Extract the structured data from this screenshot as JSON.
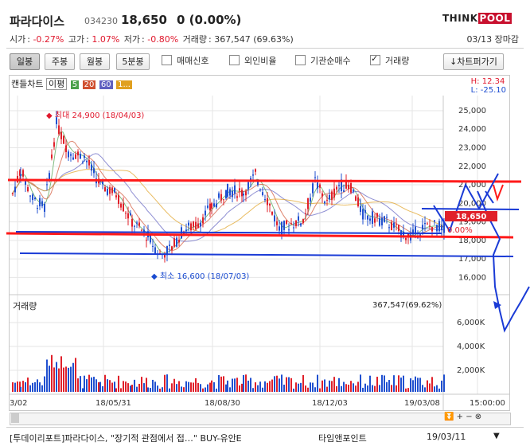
{
  "header": {
    "name": "파라다이스",
    "code": "034230",
    "price": "18,650",
    "change": "0 (0.00%)",
    "logo_think": "THINK",
    "logo_pool": "POOL",
    "start_label": "시가",
    "start_val": "-0.27%",
    "high_label": "고가",
    "high_val": "1.07%",
    "low_label": "저가",
    "low_val": "-0.80%",
    "vol_label": "거래량",
    "vol_val": "367,547 (69.63%)",
    "close_date": "03/13 장마감"
  },
  "toolbar": {
    "periods": [
      "일봉",
      "주봉",
      "월봉",
      "5분봉"
    ],
    "checks": [
      {
        "label": "매매신호",
        "checked": false
      },
      {
        "label": "외인비율",
        "checked": false
      },
      {
        "label": "기관순매수",
        "checked": false
      },
      {
        "label": "거래량",
        "checked": true
      }
    ],
    "download": "↓차트퍼가기"
  },
  "legend": {
    "chart_label": "캔들차트",
    "ma_label": "이평",
    "ma": [
      {
        "label": "5",
        "color": "#4aa04a"
      },
      {
        "label": "20",
        "color": "#d05030"
      },
      {
        "label": "60",
        "color": "#6060c0"
      },
      {
        "label": "1...",
        "color": "#e0a020"
      }
    ],
    "high_text": "H: 12.34",
    "low_text": "L: -25.10"
  },
  "chart_data": {
    "type": "candlestick",
    "price_axis": [
      "25,000",
      "24,000",
      "23,000",
      "22,000",
      "21,000",
      "20,000",
      "19,000",
      "18,000",
      "17,000",
      "16,000"
    ],
    "ylim": [
      15500,
      25600
    ],
    "current_price_tag": "18,650",
    "overlay_pct_tag": "0.00%",
    "max_label": "최대 24,900 (18/04/03)",
    "min_label": "최소 16,600 (18/07/03)",
    "volume_label": "거래량",
    "volume_value": "367,547(69.62%)",
    "volume_axis": [
      "6,000K",
      "4,000K",
      "2,000K"
    ],
    "x_labels": [
      "3/02",
      "18/05/31",
      "18/08/30",
      "18/12/03",
      "19/03/08",
      "15:00:00"
    ]
  },
  "news": {
    "title": "[투데이리포트]파라다이스, \"장기적 관점에서 접…\" BUY-유안E",
    "source": "타임앤포인트",
    "date": "19/03/11"
  }
}
